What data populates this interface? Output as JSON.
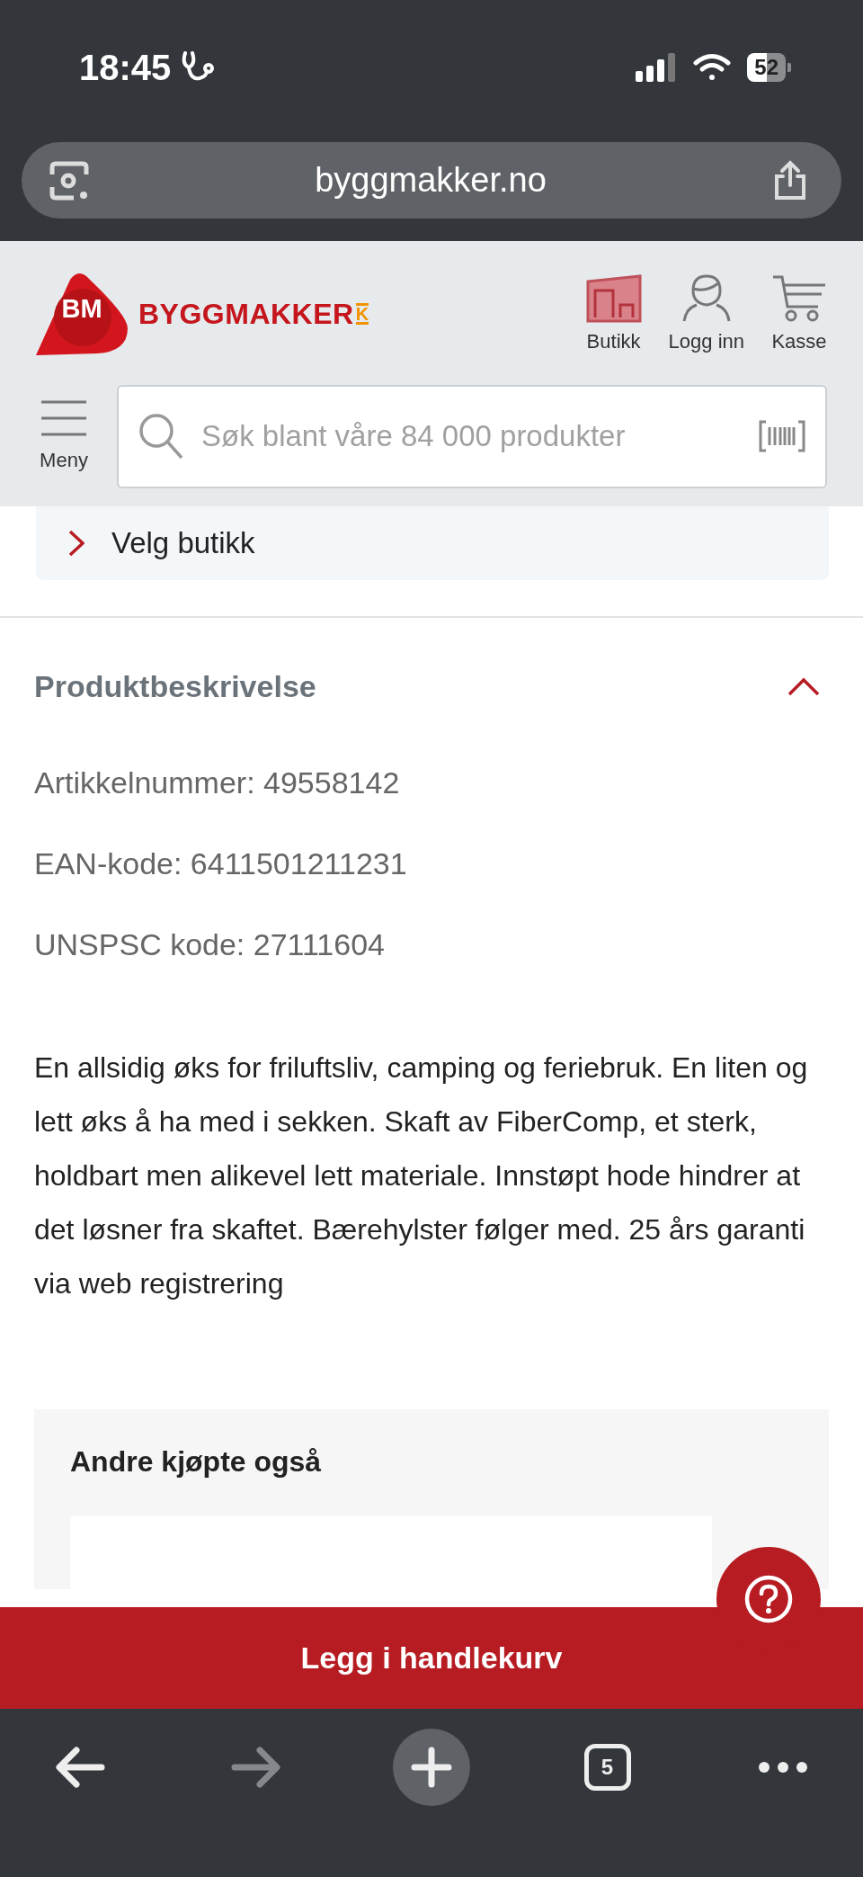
{
  "status_bar": {
    "time": "18:45",
    "battery": "52"
  },
  "browser": {
    "url": "byggmakker.no"
  },
  "header": {
    "logo_badge": "BM",
    "logo_text": "BYGGMAKKER",
    "logo_mark": "K",
    "nav_items": [
      {
        "kind": "store",
        "label": "Butikk"
      },
      {
        "kind": "user",
        "label": "Logg inn"
      },
      {
        "kind": "cart",
        "label": "Kasse"
      }
    ],
    "menu_label": "Meny",
    "search": {
      "placeholder": "Søk blant våre 84 000 produkter"
    }
  },
  "store_link": "Velg butikk",
  "description": {
    "title": "Produktbeskrivelse",
    "expanded": true,
    "specs": [
      "Artikkelnummer: 49558142",
      "EAN-kode: 6411501211231",
      "UNSPSC kode: 27111604"
    ],
    "body": "En allsidig øks for friluftsliv, camping og feriebruk. En liten og lett øks å ha med i sekken. Skaft av FiberComp, et sterk, holdbart men alikevel lett materiale. Innstøpt hode hindrer at det løsner fra skaftet. Bærehylster følger med. 25 års garanti via web registrering"
  },
  "related": {
    "title": "Andre kjøpte også"
  },
  "add_to_cart": "Legg i handlekurv",
  "toolbar": {
    "buttons": [
      {
        "kind": "back",
        "disabled": false
      },
      {
        "kind": "forward",
        "disabled": true
      },
      {
        "kind": "new-tab",
        "disabled": false
      },
      {
        "kind": "tabs",
        "label": "5",
        "disabled": false
      },
      {
        "kind": "more",
        "disabled": false
      }
    ]
  }
}
